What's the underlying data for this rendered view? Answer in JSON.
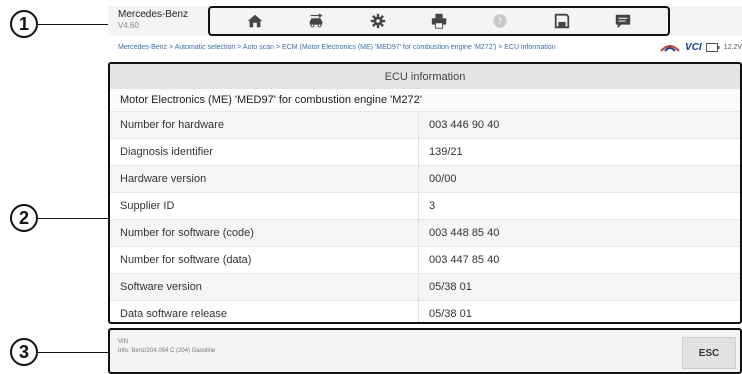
{
  "callouts": [
    "1",
    "2",
    "3"
  ],
  "header": {
    "brand": "Mercedes-Benz",
    "version": "V4.60"
  },
  "toolbar": {
    "icons": [
      "home-icon",
      "vehicle-swap-icon",
      "gear-icon",
      "printer-icon",
      "help-icon",
      "save-icon",
      "message-icon"
    ]
  },
  "breadcrumb": {
    "text": "Mercedes-Benz > Automatic selection > Auto scan > ECM (Motor Electronics (ME) 'MED97' for combustion engine 'M272') > ECU information",
    "vci_label": "VCI",
    "battery": "12.2V"
  },
  "panel": {
    "title": "ECU information",
    "subtitle": "Motor Electronics (ME) 'MED97' for combustion engine 'M272'",
    "rows": [
      {
        "label": "Number for hardware",
        "value": "003 446 90 40"
      },
      {
        "label": "Diagnosis identifier",
        "value": "139/21"
      },
      {
        "label": "Hardware version",
        "value": "00/00"
      },
      {
        "label": "Supplier ID",
        "value": "3"
      },
      {
        "label": "Number for software (code)",
        "value": "003 448 85 40"
      },
      {
        "label": "Number for software (data)",
        "value": "003 447 85 40"
      },
      {
        "label": "Software version",
        "value": "05/38 01"
      },
      {
        "label": "Data software release",
        "value": "05/38 01"
      }
    ]
  },
  "footer": {
    "vin_label": "VIN",
    "info": "Info: Benz/204.054 C (204) Gasoline",
    "esc_label": "ESC"
  },
  "colors": {
    "accent": "#1a3b8f",
    "link": "#3a6ea8",
    "border": "#111111"
  }
}
